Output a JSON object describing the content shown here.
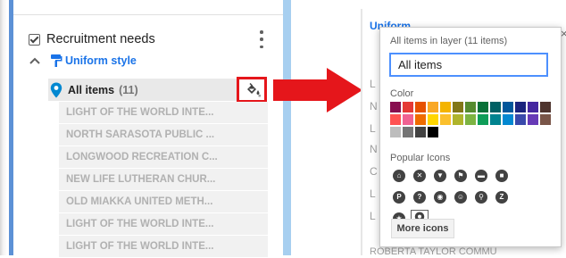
{
  "left": {
    "layer_name": "Recruitment needs",
    "style_label": "Uniform style",
    "group_label": "All items",
    "group_count": "(11)",
    "items": [
      "LIGHT OF THE WORLD INTE...",
      "NORTH SARASOTA PUBLIC ...",
      "LONGWOOD RECREATION C...",
      "NEW LIFE LUTHERAN CHUR...",
      "OLD MIAKKA UNITED METH...",
      "LIGHT OF THE WORLD INTE...",
      "LIGHT OF THE WORLD INTE..."
    ]
  },
  "icons": {
    "checkbox": "checkbox-checked-icon",
    "menu": "more-vert-icon",
    "collapse": "chevron-up-icon",
    "style": "paint-roller-icon",
    "marker": "map-pin-icon",
    "fill": "paint-bucket-icon",
    "arrow": "red-arrow-icon",
    "close": "close-icon"
  },
  "background": {
    "title": "Uniform style",
    "letters": [
      "L",
      "N",
      "L",
      "N",
      "C",
      "L",
      "L"
    ],
    "bottom": "ROBERTA TAYLOR COMMU"
  },
  "popup": {
    "header": "All items in layer  (11 items)",
    "name_value": "All items",
    "color_label": "Color",
    "icons_label": "Popular Icons",
    "more_icons": "More icons",
    "close_glyph": "×",
    "colors": [
      "#880e4f",
      "#e53935",
      "#e65100",
      "#f9a825",
      "#f4b400",
      "#827717",
      "#558b2f",
      "#097138",
      "#006064",
      "#01579b",
      "#1a237e",
      "#4527a0",
      "#4e342e",
      "#ff5252",
      "#f06292",
      "#ef6c00",
      "#ffd600",
      "#fbc02d",
      "#afb42b",
      "#7cb342",
      "#0f9d58",
      "#00838f",
      "#0288d1",
      "#3949ab",
      "#673ab7",
      "#795548",
      "#bdbdbd",
      "#757575",
      "#424242",
      "#000000"
    ],
    "icon_names": [
      "home-icon",
      "restaurant-icon",
      "cocktail-icon",
      "flag-icon",
      "bus-icon",
      "shopping-bag-icon",
      "parking-icon",
      "help-icon",
      "camera-icon",
      "walking-icon",
      "cycling-icon",
      "transit-icon",
      "star-icon",
      "place-marker-icon"
    ],
    "icon_glyphs": [
      "⌂",
      "✕",
      "▼",
      "⚑",
      "▬",
      "■",
      "P",
      "?",
      "◉",
      "☺",
      "⚲",
      "Z",
      "★",
      "●"
    ],
    "selected_icon": "place-marker-icon"
  },
  "colors": {
    "accent_blue": "#1a73e8",
    "highlight_red": "#e5161b",
    "panel_accent": "#5c91d6",
    "pin_blue": "#0288d1"
  }
}
